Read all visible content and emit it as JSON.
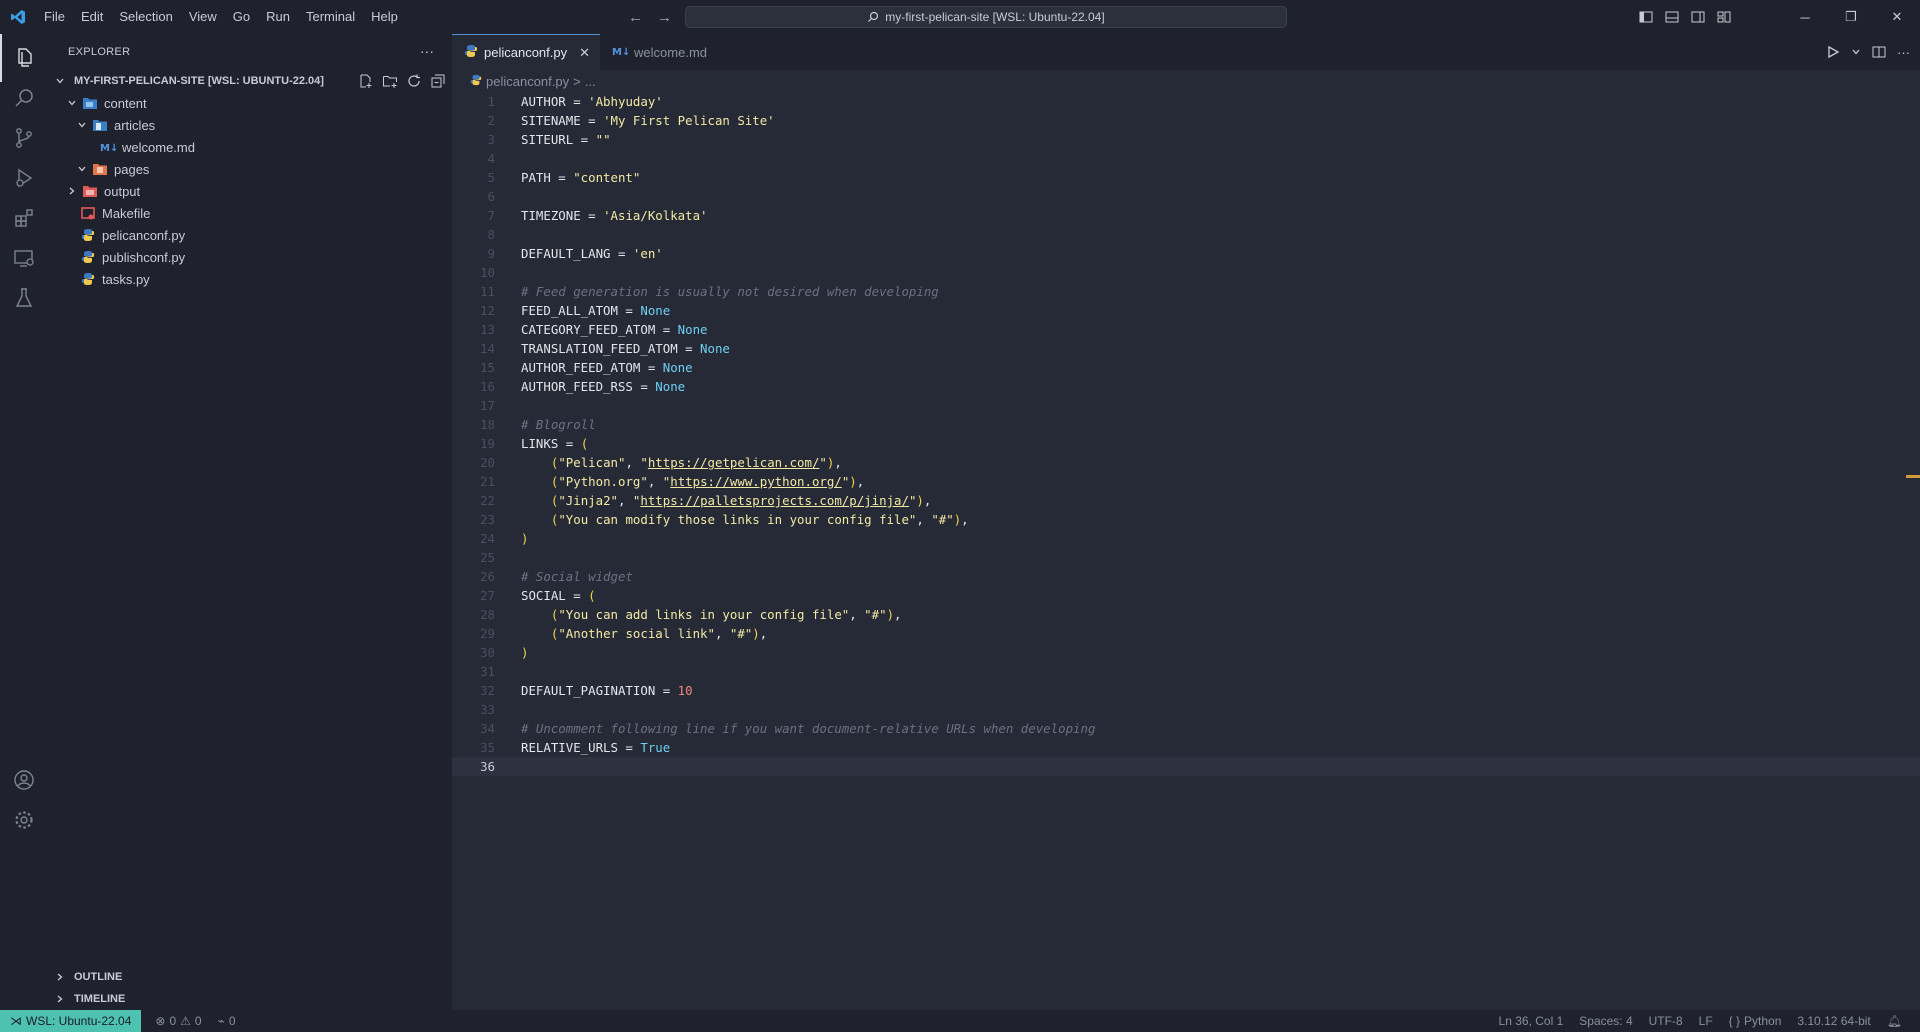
{
  "menu": [
    "File",
    "Edit",
    "Selection",
    "View",
    "Go",
    "Run",
    "Terminal",
    "Help"
  ],
  "command_center": "my-first-pelican-site [WSL: Ubuntu-22.04]",
  "explorer": {
    "title": "EXPLORER",
    "more": "···",
    "folder": "MY-FIRST-PELICAN-SITE [WSL: UBUNTU-22.04]",
    "items": [
      {
        "label": "content",
        "type": "folder",
        "open": true
      },
      {
        "label": "articles",
        "type": "folder",
        "open": true
      },
      {
        "label": "welcome.md",
        "type": "md"
      },
      {
        "label": "pages",
        "type": "folder",
        "open": true
      },
      {
        "label": "output",
        "type": "folder",
        "open": false
      },
      {
        "label": "Makefile",
        "type": "make"
      },
      {
        "label": "pelicanconf.py",
        "type": "py"
      },
      {
        "label": "publishconf.py",
        "type": "py"
      },
      {
        "label": "tasks.py",
        "type": "py"
      }
    ],
    "outline": "OUTLINE",
    "timeline": "TIMELINE"
  },
  "tabs": [
    {
      "label": "pelicanconf.py",
      "active": true
    },
    {
      "label": "welcome.md",
      "active": false
    }
  ],
  "breadcrumb": {
    "file": "pelicanconf.py",
    "sep": ">",
    "rest": "..."
  },
  "code_lines": [
    "AUTHOR = 'Abhyuday'",
    "SITENAME = 'My First Pelican Site'",
    "SITEURL = \"\"",
    "",
    "PATH = \"content\"",
    "",
    "TIMEZONE = 'Asia/Kolkata'",
    "",
    "DEFAULT_LANG = 'en'",
    "",
    "# Feed generation is usually not desired when developing",
    "FEED_ALL_ATOM = None",
    "CATEGORY_FEED_ATOM = None",
    "TRANSLATION_FEED_ATOM = None",
    "AUTHOR_FEED_ATOM = None",
    "AUTHOR_FEED_RSS = None",
    "",
    "# Blogroll",
    "LINKS = (",
    "    (\"Pelican\", \"https://getpelican.com/\"),",
    "    (\"Python.org\", \"https://www.python.org/\"),",
    "    (\"Jinja2\", \"https://palletsprojects.com/p/jinja/\"),",
    "    (\"You can modify those links in your config file\", \"#\"),",
    ")",
    "",
    "# Social widget",
    "SOCIAL = (",
    "    (\"You can add links in your config file\", \"#\"),",
    "    (\"Another social link\", \"#\"),",
    ")",
    "",
    "DEFAULT_PAGINATION = 10",
    "",
    "# Uncomment following line if you want document-relative URLs when developing",
    "RELATIVE_URLS = True",
    ""
  ],
  "current_line": 36,
  "status": {
    "remote": "WSL: Ubuntu-22.04",
    "errors": "0",
    "warnings": "0",
    "ports": "0",
    "position": "Ln 36, Col 1",
    "spaces": "Spaces: 4",
    "encoding": "UTF-8",
    "eol": "LF",
    "language": "Python",
    "interpreter": "3.10.12 64-bit"
  },
  "colors": {
    "background": "#262a37",
    "sidebar": "#1f222d",
    "remote": "#4ec2b0",
    "accent": "#4f8fd6"
  }
}
